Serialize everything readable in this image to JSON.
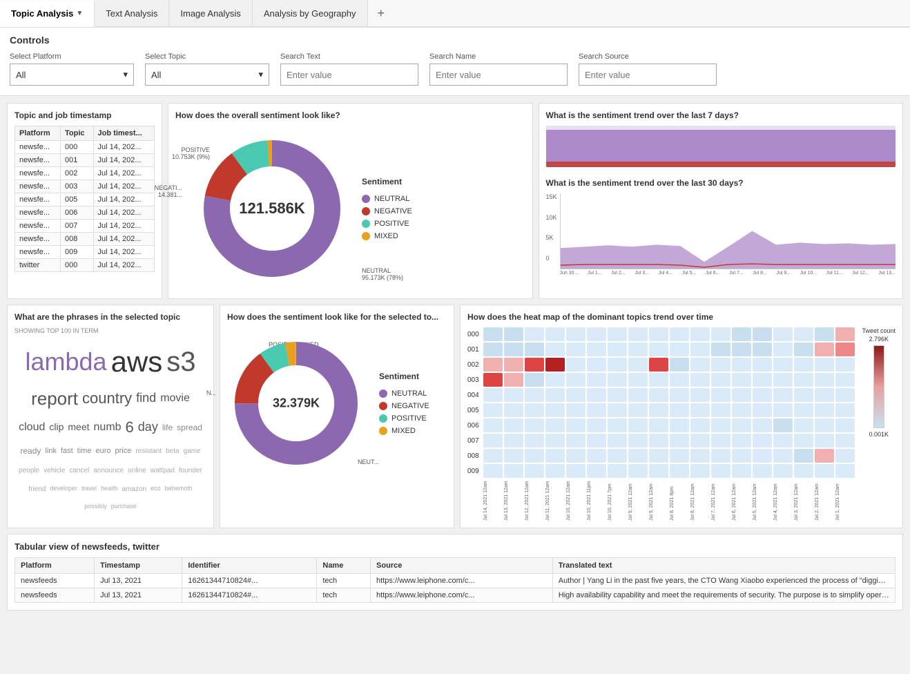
{
  "tabs": [
    {
      "label": "Topic Analysis",
      "active": true,
      "hasArrow": true
    },
    {
      "label": "Text Analysis",
      "active": false,
      "hasArrow": false
    },
    {
      "label": "Image Analysis",
      "active": false,
      "hasArrow": false
    },
    {
      "label": "Analysis by Geography",
      "active": false,
      "hasArrow": false
    }
  ],
  "controls": {
    "title": "Controls",
    "platform": {
      "label": "Select Platform",
      "value": "All"
    },
    "topic": {
      "label": "Select Topic",
      "value": "All"
    },
    "searchText": {
      "label": "Search Text",
      "placeholder": "Enter value"
    },
    "searchName": {
      "label": "Search Name",
      "placeholder": "Enter value"
    },
    "searchSource": {
      "label": "Search Source",
      "placeholder": "Enter value"
    }
  },
  "topicTable": {
    "title": "Topic and job timestamp",
    "columns": [
      "Platform",
      "Topic",
      "Job timest..."
    ],
    "rows": [
      [
        "newsfe...",
        "000",
        "Jul 14, 202..."
      ],
      [
        "newsfe...",
        "001",
        "Jul 14, 202..."
      ],
      [
        "newsfe...",
        "002",
        "Jul 14, 202..."
      ],
      [
        "newsfe...",
        "003",
        "Jul 14, 202..."
      ],
      [
        "newsfe...",
        "005",
        "Jul 14, 202..."
      ],
      [
        "newsfe...",
        "006",
        "Jul 14, 202..."
      ],
      [
        "newsfe...",
        "007",
        "Jul 14, 202..."
      ],
      [
        "newsfe...",
        "008",
        "Jul 14, 202..."
      ],
      [
        "newsfe...",
        "009",
        "Jul 14, 202..."
      ],
      [
        "twitter",
        "000",
        "Jul 14, 202..."
      ]
    ]
  },
  "overallSentiment": {
    "title": "How does the overall sentiment look like?",
    "total": "121.586K",
    "labels": {
      "positive": "POSITIVE 10.753K (9%)",
      "negative": "NEGATI... 14.381...",
      "neutral": "NEUTRAL 95.173K (78%)"
    },
    "legend": {
      "title": "Sentiment",
      "items": [
        {
          "label": "NEUTRAL",
          "color": "#8b68b0"
        },
        {
          "label": "NEGATIVE",
          "color": "#c0392b"
        },
        {
          "label": "POSITIVE",
          "color": "#48c9b0"
        },
        {
          "label": "MIXED",
          "color": "#e8a020"
        }
      ]
    },
    "segments": [
      {
        "value": 78,
        "color": "#8b68b0"
      },
      {
        "value": 12,
        "color": "#c0392b"
      },
      {
        "value": 9,
        "color": "#48c9b0"
      },
      {
        "value": 1,
        "color": "#e8a020"
      }
    ]
  },
  "trend7days": {
    "title": "What is the sentiment trend over the last 7 days?"
  },
  "trend30days": {
    "title": "What is the sentiment trend over the last 30 days?",
    "yLabels": [
      "15K",
      "10K",
      "5K",
      "0"
    ],
    "xLabels": [
      "Jun 30...",
      "Jul 1...",
      "Jul 2...",
      "Jul 3...",
      "Jul 4...",
      "Jul 5...",
      "Jul 6...",
      "Jul 7...",
      "Jul 8...",
      "Jul 9...",
      "Jul 10...",
      "Jul 11...",
      "Jul 12...",
      "Jul 13..."
    ]
  },
  "wordCloud": {
    "title": "What are the phrases in the selected topic",
    "subtitle": "SHOWING TOP 100 IN TERM",
    "words": [
      {
        "text": "lambda",
        "size": 36,
        "color": "#8b68b0"
      },
      {
        "text": "aws",
        "size": 42,
        "color": "#333"
      },
      {
        "text": "s3",
        "size": 40,
        "color": "#555"
      },
      {
        "text": "report",
        "size": 26,
        "color": "#555"
      },
      {
        "text": "country",
        "size": 22,
        "color": "#555"
      },
      {
        "text": "find",
        "size": 18,
        "color": "#555"
      },
      {
        "text": "movie",
        "size": 16,
        "color": "#555"
      },
      {
        "text": "cloud",
        "size": 16,
        "color": "#555"
      },
      {
        "text": "clip",
        "size": 14,
        "color": "#555"
      },
      {
        "text": "meet",
        "size": 14,
        "color": "#555"
      },
      {
        "text": "numb",
        "size": 16,
        "color": "#555"
      },
      {
        "text": "6",
        "size": 22,
        "color": "#555"
      },
      {
        "text": "day",
        "size": 18,
        "color": "#555"
      },
      {
        "text": "life",
        "size": 12,
        "color": "#888"
      },
      {
        "text": "spread",
        "size": 12,
        "color": "#888"
      },
      {
        "text": "ready",
        "size": 12,
        "color": "#888"
      },
      {
        "text": "link",
        "size": 11,
        "color": "#888"
      },
      {
        "text": "fast",
        "size": 11,
        "color": "#888"
      },
      {
        "text": "time",
        "size": 11,
        "color": "#888"
      },
      {
        "text": "euro",
        "size": 11,
        "color": "#888"
      },
      {
        "text": "price",
        "size": 11,
        "color": "#888"
      },
      {
        "text": "resistant",
        "size": 10,
        "color": "#aaa"
      },
      {
        "text": "beta",
        "size": 10,
        "color": "#aaa"
      },
      {
        "text": "game",
        "size": 10,
        "color": "#aaa"
      },
      {
        "text": "people",
        "size": 10,
        "color": "#aaa"
      },
      {
        "text": "vehicle",
        "size": 10,
        "color": "#aaa"
      },
      {
        "text": "cancel",
        "size": 10,
        "color": "#aaa"
      },
      {
        "text": "announce",
        "size": 10,
        "color": "#aaa"
      },
      {
        "text": "online",
        "size": 10,
        "color": "#aaa"
      },
      {
        "text": "wattpad",
        "size": 10,
        "color": "#aaa"
      },
      {
        "text": "founder",
        "size": 10,
        "color": "#aaa"
      },
      {
        "text": "friend",
        "size": 10,
        "color": "#aaa"
      },
      {
        "text": "developer",
        "size": 9,
        "color": "#aaa"
      },
      {
        "text": "travel",
        "size": 9,
        "color": "#aaa"
      },
      {
        "text": "health",
        "size": 9,
        "color": "#aaa"
      },
      {
        "text": "amazon",
        "size": 10,
        "color": "#aaa"
      },
      {
        "text": "eco",
        "size": 9,
        "color": "#aaa"
      },
      {
        "text": "behemoth",
        "size": 9,
        "color": "#aaa"
      },
      {
        "text": "possibly",
        "size": 9,
        "color": "#aaa"
      },
      {
        "text": "purchase",
        "size": 9,
        "color": "#aaa"
      }
    ]
  },
  "selectedSentiment": {
    "title": "How does the sentiment look like for the selected to...",
    "total": "32.379K",
    "labels": {
      "positive": "POSITIVE",
      "mixed": "MIXED",
      "neutral": "NEUT..."
    },
    "legend": {
      "title": "Sentiment",
      "items": [
        {
          "label": "NEUTRAL",
          "color": "#8b68b0"
        },
        {
          "label": "NEGATIVE",
          "color": "#c0392b"
        },
        {
          "label": "POSITIVE",
          "color": "#48c9b0"
        },
        {
          "label": "MIXED",
          "color": "#e8a020"
        }
      ]
    }
  },
  "heatmap": {
    "title": "How does the heat map of the dominant topics trend over time",
    "rowLabels": [
      "000",
      "001",
      "002",
      "003",
      "004",
      "005",
      "006",
      "007",
      "008",
      "009"
    ],
    "legendTitle": "Tweet count",
    "legendMax": "2.796K",
    "legendMin": "0.001K",
    "xLabels": [
      "Jul 14, 2021 12am",
      "Jul 13, 2021 12am",
      "Jul 12, 2021 12am",
      "Jul 11, 2021 12am",
      "Jul 10, 2021 12am",
      "Jul 10, 2021 11pm",
      "Jul 10, 2021 7pm",
      "Jul 9, 2021 12am",
      "Jul 9, 2021 12am",
      "Jul 8, 2021 8pm",
      "Jul 8, 2021 12am",
      "Jul 7, 2021 12am",
      "Jul 6, 2021 12am",
      "Jul 5, 2021 12am",
      "Jul 4, 2021 12am",
      "Jul 3, 2021 12am",
      "Jul 2, 2021 12am",
      "Jul 1, 2021 12am"
    ]
  },
  "bottomTable": {
    "title": "Tabular view of newsfeeds, twitter",
    "columns": [
      "Platform",
      "Timestamp",
      "Identifier",
      "Name",
      "Source",
      "Translated text"
    ],
    "rows": [
      {
        "platform": "newsfeeds",
        "timestamp": "Jul 13, 2021",
        "identifier": "16261344710824#...",
        "name": "tech",
        "source": "https://www.leiphone.com/c...",
        "text": "Author | Yang Li in the past five years, the CTO Wang Xiaobo experienced the process of \"digging\" and \"filling pit\", s..."
      },
      {
        "platform": "newsfeeds",
        "timestamp": "Jul 13, 2021",
        "identifier": "16261344710824#...",
        "name": "tech",
        "source": "https://www.leiphone.com/c...",
        "text": "High availability capability and meet the requirements of security. The purpose is to simplify operational tasks in de..."
      }
    ]
  }
}
